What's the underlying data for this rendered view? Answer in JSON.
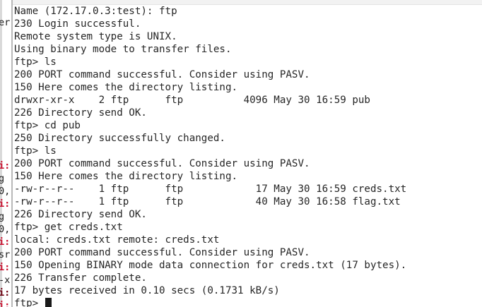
{
  "terminal": {
    "lines": [
      "Name (172.17.0.3:test): ftp",
      "230 Login successful.",
      "Remote system type is UNIX.",
      "Using binary mode to transfer files.",
      "ftp> ls",
      "200 PORT command successful. Consider using PASV.",
      "150 Here comes the directory listing.",
      "drwxr-xr-x    2 ftp      ftp          4096 May 30 16:59 pub",
      "226 Directory send OK.",
      "ftp> cd pub",
      "250 Directory successfully changed.",
      "ftp> ls",
      "200 PORT command successful. Consider using PASV.",
      "150 Here comes the directory listing.",
      "-rw-r--r--    1 ftp      ftp            17 May 30 16:59 creds.txt",
      "-rw-r--r--    1 ftp      ftp            40 May 30 16:58 flag.txt",
      "226 Directory send OK.",
      "ftp> get creds.txt",
      "local: creds.txt remote: creds.txt",
      "200 PORT command successful. Consider using PASV.",
      "150 Opening BINARY mode data connection for creds.txt (17 bytes).",
      "226 Transfer complete.",
      "17 bytes received in 0.10 secs (0.1731 kB/s)"
    ],
    "prompt": "ftp> "
  },
  "background_window": {
    "fragments": [
      {
        "text": "er",
        "style": "plain"
      },
      {
        "text": "i:",
        "style": "red"
      },
      {
        "text": "g",
        "style": "plain"
      },
      {
        "text": "0,",
        "style": "plain"
      },
      {
        "text": "i:",
        "style": "red"
      },
      {
        "text": "g",
        "style": "plain"
      },
      {
        "text": "0,",
        "style": "plain"
      },
      {
        "text": "i:",
        "style": "red"
      },
      {
        "text": "sr",
        "style": "plain"
      },
      {
        "text": "i:",
        "style": "red"
      },
      {
        "text": "-x",
        "style": "plain"
      },
      {
        "text": "i:",
        "style": "dark"
      },
      {
        "text": "i:",
        "style": "red"
      }
    ]
  }
}
